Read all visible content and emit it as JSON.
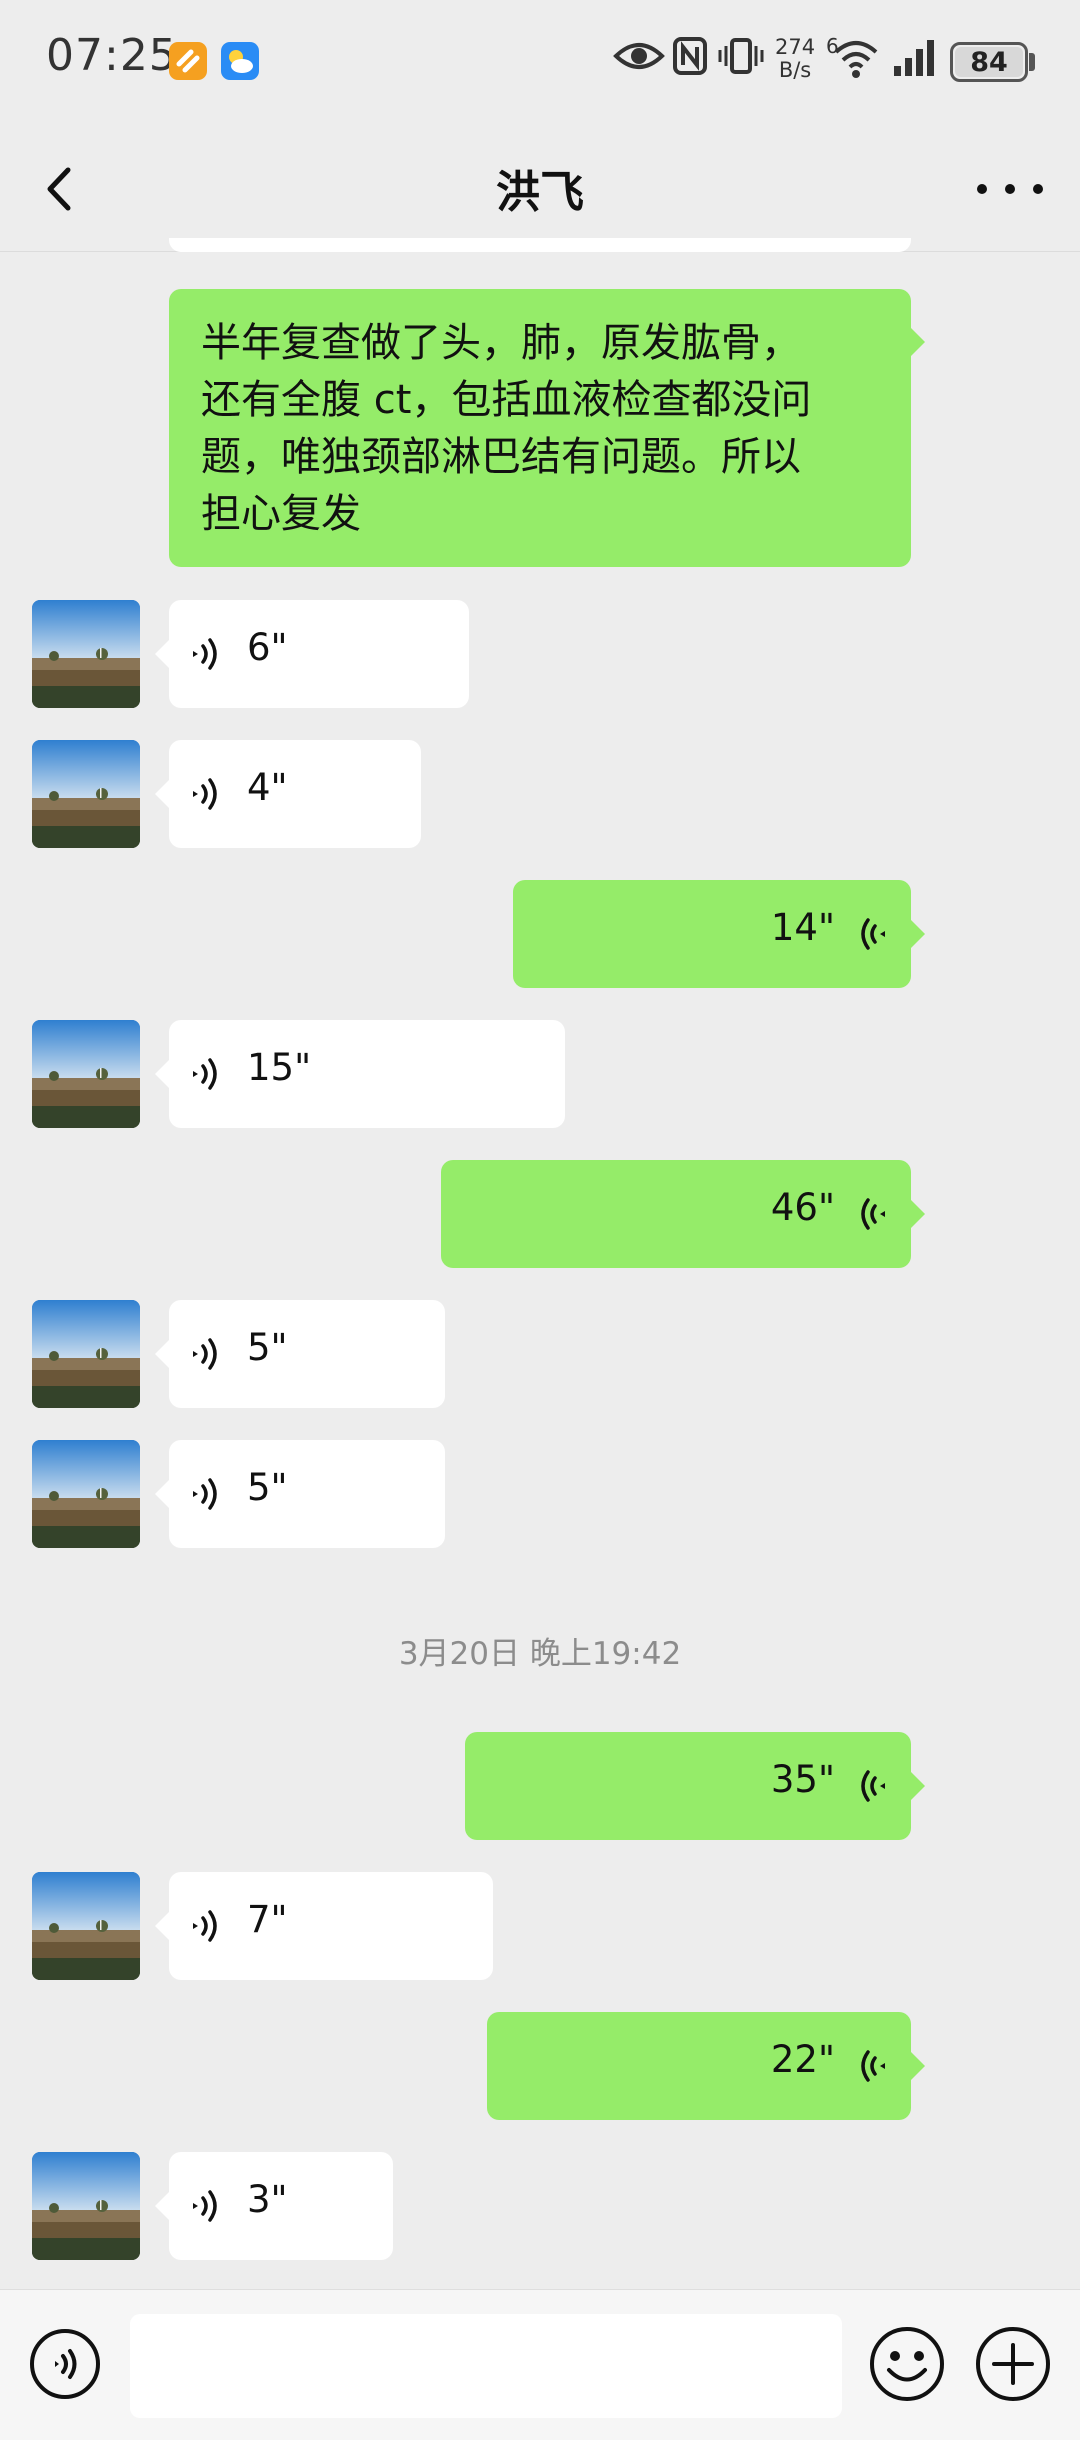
{
  "status_bar": {
    "time": "07:25",
    "net_speed_value": "274",
    "net_speed_unit": "B/s",
    "network_type": "6",
    "battery": "84",
    "battery_level": 0.84,
    "icons": [
      "app-notification-icon",
      "weather-app-icon",
      "eye-icon",
      "nfc-icon",
      "vibrate-icon",
      "wifi-icon",
      "signal-icon",
      "battery-icon"
    ]
  },
  "header": {
    "title": "洪飞",
    "back_icon": "chevron-left-icon",
    "more_icon": "more-dots-icon"
  },
  "messages": {
    "text_message": {
      "lines": [
        "半年复查做了头，肺，原发肱骨，",
        "还有全腹 ct，包括血液检查都没问",
        "题，唯独颈部淋巴结有问题。所以",
        "担心复发"
      ]
    },
    "voice": [
      {
        "side": "in",
        "duration": "6\""
      },
      {
        "side": "in",
        "duration": "4\""
      },
      {
        "side": "out",
        "duration": "14\""
      },
      {
        "side": "in",
        "duration": "15\""
      },
      {
        "side": "out",
        "duration": "46\""
      },
      {
        "side": "in",
        "duration": "5\""
      },
      {
        "side": "in",
        "duration": "5\""
      },
      {
        "side": "out",
        "duration": "35\""
      },
      {
        "side": "in",
        "duration": "7\""
      },
      {
        "side": "out",
        "duration": "22\""
      },
      {
        "side": "in",
        "duration": "3\""
      }
    ],
    "timestamp": "3月20日 晚上19:42"
  },
  "input_bar": {
    "voice_icon": "voice-input-icon",
    "emoji_icon": "emoji-icon",
    "plus_icon": "plus-icon",
    "placeholder": ""
  },
  "colors": {
    "background": "#ededed",
    "outgoing_bubble": "#95ec69",
    "incoming_bubble": "#ffffff",
    "timestamp_text": "#8c8c8c"
  }
}
